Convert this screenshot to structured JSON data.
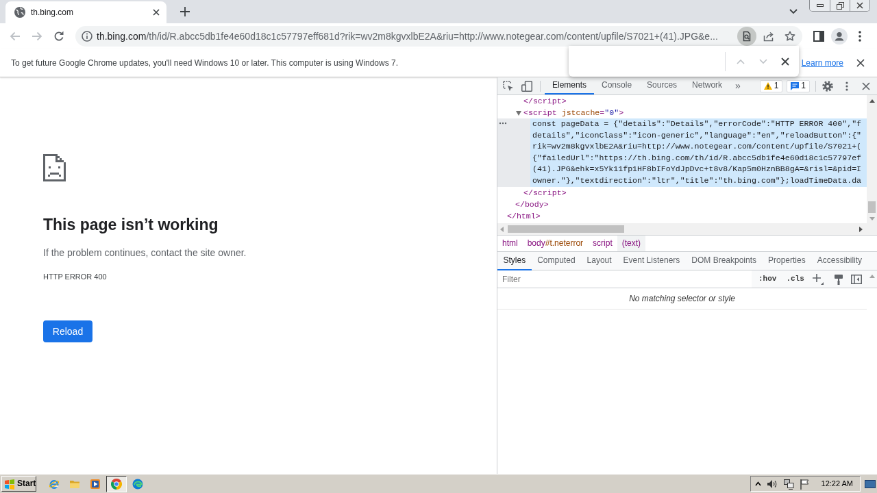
{
  "browser": {
    "tabs": [
      {
        "title": "th.bing.com",
        "selected": true
      }
    ],
    "navigation": {
      "back_disabled": true,
      "forward_disabled": true
    },
    "address_bar": {
      "host": "th.bing.com",
      "path": "/th/id/R.abcc5db1fe4e60d18c1c57797eff681d?rik=wv2m8kgvxlbE2A&riu=http://www.notegear.com/content/upfile/S7021+(41).JPG&e..."
    },
    "infobar": {
      "message": "To get future Google Chrome updates, you'll need Windows 10 or later. This computer is using Windows 7.",
      "link": "Learn more"
    },
    "find_bar": {
      "navigation_disabled": true
    }
  },
  "page": {
    "title": "This page isn’t working",
    "message": "If the problem continues, contact the site owner.",
    "error_code": "HTTP ERROR 400",
    "reload_button": "Reload"
  },
  "devtools": {
    "tabs": [
      {
        "label": "Elements",
        "selected": true
      },
      {
        "label": "Console",
        "selected": false
      },
      {
        "label": "Sources",
        "selected": false
      },
      {
        "label": "Network",
        "selected": false
      }
    ],
    "more_tabs": "»",
    "warning_count": "1",
    "message_count": "1",
    "dom_tree": [
      {
        "closing": "</html>",
        "children": [
          {
            "closing": "</body>",
            "children": [
              {
                "tokens": [
                  {
                    "kind": "tag",
                    "text": "</script>"
                  }
                ]
              },
              {
                "tokens": [
                  {
                    "kind": "tag",
                    "text": "<script "
                  },
                  {
                    "kind": "attribute",
                    "text": "jstcache"
                  },
                  {
                    "kind": "tag",
                    "text": "="
                  },
                  {
                    "kind": "value",
                    "text": "\"0\""
                  },
                  {
                    "kind": "tag",
                    "text": ">"
                  }
                ],
                "expanded": true,
                "closing": "</script>",
                "children": [
                  {
                    "kind": "text",
                    "selected": true,
                    "lines": [
                      "const pageData = {\"details\":\"Details\",\"errorCode\":\"HTTP ERROR 400\",\"f",
                      "details\",\"iconClass\":\"icon-generic\",\"language\":\"en\",\"reloadButton\":{\"",
                      "rik=wv2m8kgvxlbE2A&riu=http://www.notegear.com/content/upfile/S7021+(",
                      "{\"failedUrl\":\"https://th.bing.com/th/id/R.abcc5db1fe4e60d18c1c57797ef",
                      "(41).JPG&ehk=x5Yk11fp1HF8bIFoYdJpDvc+t8v8/Kap5m0HznBB8gA=&risl=&pid=I",
                      "owner.\"},\"textdirection\":\"ltr\",\"title\":\"th.bing.com\"};loadTimeData.da"
                    ]
                  }
                ]
              }
            ]
          }
        ]
      }
    ],
    "breadcrumbs": [
      {
        "label": "html",
        "selected": false
      },
      {
        "label": "body",
        "selector": "#t.neterror",
        "selected": false
      },
      {
        "label": "script",
        "selected": false
      },
      {
        "label": "(text)",
        "selected": true
      }
    ],
    "sidebar_tabs": [
      {
        "label": "Styles",
        "selected": true
      },
      {
        "label": "Computed",
        "selected": false
      },
      {
        "label": "Layout",
        "selected": false
      },
      {
        "label": "Event Listeners",
        "selected": false
      },
      {
        "label": "DOM Breakpoints",
        "selected": false
      },
      {
        "label": "Properties",
        "selected": false
      },
      {
        "label": "Accessibility",
        "selected": false
      }
    ],
    "filter": {
      "placeholder": "Filter"
    },
    "toggles": [
      ":hov",
      ".cls"
    ],
    "empty_message": "No matching selector or style"
  },
  "taskbar": {
    "start": "Start",
    "apps": [
      {
        "kind": "ie",
        "selected": false
      },
      {
        "kind": "folder",
        "selected": false
      },
      {
        "kind": "media",
        "selected": false
      },
      {
        "kind": "chrome",
        "selected": true
      },
      {
        "kind": "edge",
        "selected": false
      }
    ],
    "clock": "12:22 AM"
  }
}
